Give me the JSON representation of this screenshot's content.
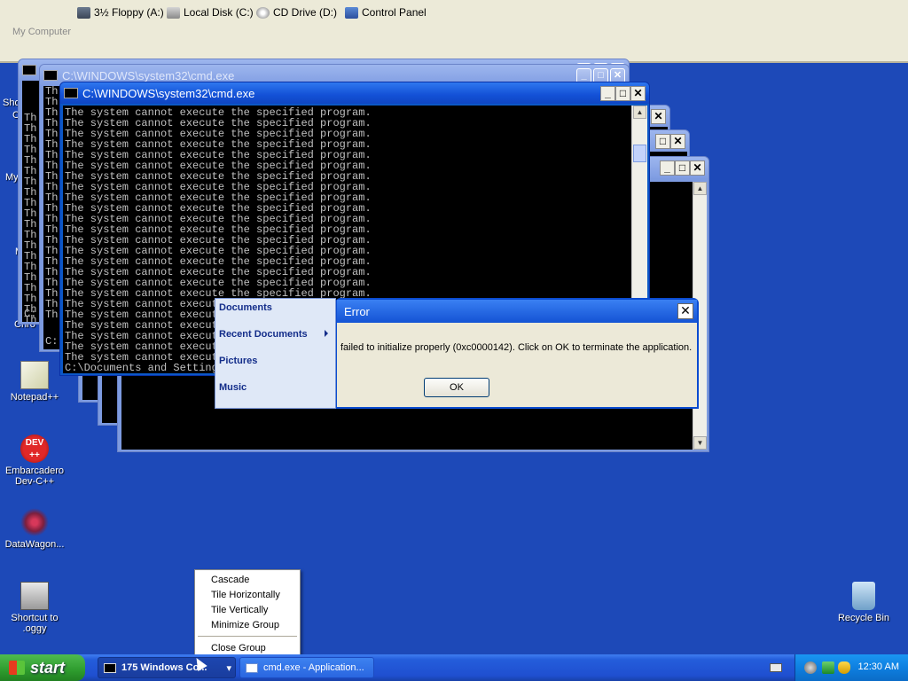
{
  "explorer": {
    "drives": [
      {
        "label": "3½ Floppy (A:)",
        "icon": "floppy-icon"
      },
      {
        "label": "Local Disk (C:)",
        "icon": "disk-icon"
      },
      {
        "label": "CD Drive (D:)",
        "icon": "cd-icon"
      },
      {
        "label": "Control Panel",
        "icon": "control-panel-icon"
      }
    ],
    "address_label": "My Computer"
  },
  "desktop": {
    "partial_labels": {
      "a": "Sho",
      "b": "C",
      "c": "My",
      "d": "M",
      "e": "Chro"
    },
    "icons": [
      {
        "label": "Notepad++",
        "icon": "notepad-plus-plus-icon"
      },
      {
        "label": "Embarcadero Dev-C++",
        "icon": "dev-cpp-icon",
        "badge": "DEV\n++"
      },
      {
        "label": "DataWagon...",
        "icon": "datawagon-icon"
      },
      {
        "label": "Shortcut to .oggy",
        "icon": "shortcut-icon"
      },
      {
        "label": "Recycle Bin",
        "icon": "recycle-bin-icon"
      }
    ]
  },
  "cmd_windows": {
    "title": "C:\\WINDOWS\\system32\\cmd.exe",
    "error_line": "The system cannot execute the specified program.",
    "prompt": "C:\\Documents and Settings\\...",
    "back_prompt_1": "C:",
    "back_prompt_2": "C:",
    "back_line_prefix": "Th"
  },
  "error_dialog": {
    "title": "Error",
    "message": "failed to initialize properly (0xc0000142). Click on OK to terminate the application.",
    "ok_label": "OK",
    "close_glyph": "✕"
  },
  "flyout": {
    "items": [
      "Documents",
      "Recent Documents",
      "Pictures",
      "Music"
    ]
  },
  "context_menu": {
    "items": [
      "Cascade",
      "Tile Horizontally",
      "Tile Vertically",
      "Minimize Group"
    ],
    "close_item": "Close Group"
  },
  "taskbar": {
    "start_label": "start",
    "tasks": [
      "175 Windows Co...",
      "cmd.exe - Application..."
    ],
    "clock": "12:30 AM"
  },
  "colors": {
    "desktop": "#1d49b8",
    "titlebar_active": "#1350d6",
    "start_green": "#2e9c2e"
  }
}
